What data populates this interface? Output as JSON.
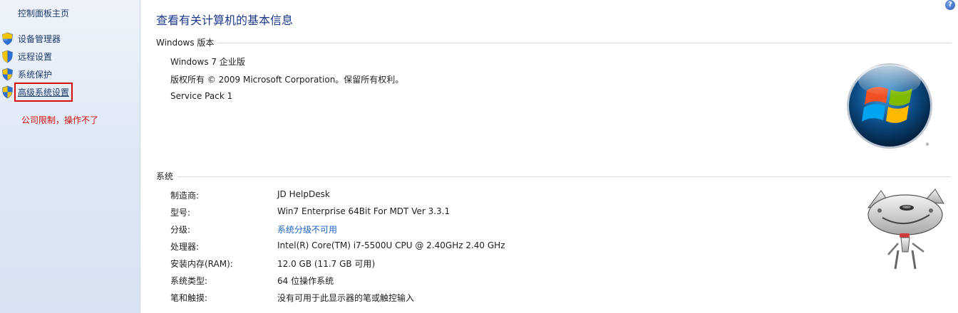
{
  "sidebar": {
    "home_label": "控制面板主页",
    "items": [
      {
        "label": "设备管理器",
        "icon": "uac-shield-icon"
      },
      {
        "label": "远程设置",
        "icon": "uac-shield-icon"
      },
      {
        "label": "系统保护",
        "icon": "uac-shield-icon"
      },
      {
        "label": "高级系统设置",
        "icon": "uac-shield-icon"
      }
    ],
    "annotation": "公司限制，操作不了",
    "annotation_color": "#d40f0f"
  },
  "help": {
    "icon": "help-icon",
    "glyph": "?"
  },
  "main": {
    "page_title": "查看有关计算机的基本信息",
    "edition_section": {
      "title": "Windows 版本",
      "lines": [
        "Windows 7 企业版",
        "版权所有 © 2009 Microsoft Corporation。保留所有权利。",
        "Service Pack 1"
      ]
    },
    "system_section": {
      "title": "系统",
      "rows": [
        {
          "label": "制造商:",
          "value": "JD HelpDesk"
        },
        {
          "label": "型号:",
          "value": "Win7 Enterprise 64Bit For MDT Ver 3.3.1"
        },
        {
          "label": "分级:",
          "value": "系统分级不可用"
        },
        {
          "label": "处理器:",
          "value": "Intel(R) Core(TM) i7-5500U CPU @ 2.40GHz   2.40 GHz"
        },
        {
          "label": "安装内存(RAM):",
          "value": "12.0 GB (11.7 GB 可用)"
        },
        {
          "label": "系统类型:",
          "value": "64 位操作系统"
        },
        {
          "label": "笔和触摸:",
          "value": "没有可用于此显示器的笔或触控输入"
        }
      ]
    }
  },
  "colors": {
    "title_blue": "#1e3a8a",
    "link_blue": "#1d65c3",
    "highlight_red": "#d80e0e"
  }
}
